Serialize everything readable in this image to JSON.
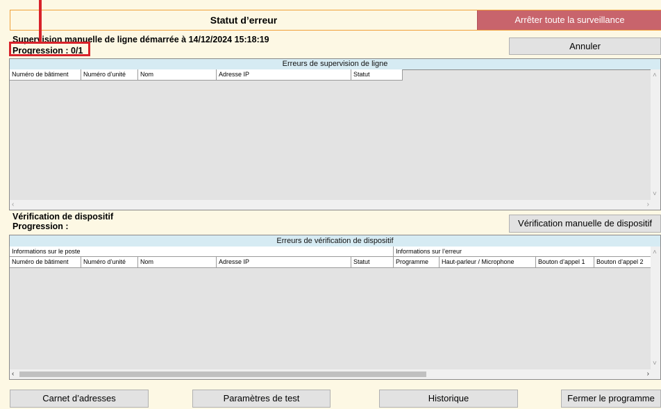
{
  "header": {
    "title": "Statut d’erreur",
    "stop_all_label": "Arrêter toute la surveillance"
  },
  "line_supervision": {
    "status_text": "Supervision manuelle de ligne démarrée à 14/12/2024 15:18:19",
    "progress_text": "Progression : 0/1",
    "cancel_label": "Annuler",
    "panel_title": "Erreurs de supervision de ligne",
    "columns": [
      "Numéro de bâtiment",
      "Numéro d’unité",
      "Nom",
      "Adresse IP",
      "Statut"
    ]
  },
  "device_check": {
    "section_label": "Vérification de dispositif",
    "progress_text": "Progression :",
    "manual_button_label": "Vérification manuelle de dispositif",
    "panel_title": "Erreurs de vérification de dispositif",
    "group_station": "Informations sur le poste",
    "group_error": "Informations sur l’erreur",
    "columns": [
      "Numéro de bâtiment",
      "Numéro d’unité",
      "Nom",
      "Adresse IP",
      "Statut",
      "Programme",
      "Haut-parleur / Microphone",
      "Bouton d’appel 1",
      "Bouton d’appel 2"
    ]
  },
  "footer": {
    "address_book_label": "Carnet d’adresses",
    "test_params_label": "Paramètres de test",
    "history_label": "Historique",
    "close_label": "Fermer le programme"
  },
  "colors": {
    "accent_border": "#f0a038",
    "stop_button": "#c8646c",
    "highlight": "#d8222a",
    "panel_header": "#d6ebf3"
  }
}
